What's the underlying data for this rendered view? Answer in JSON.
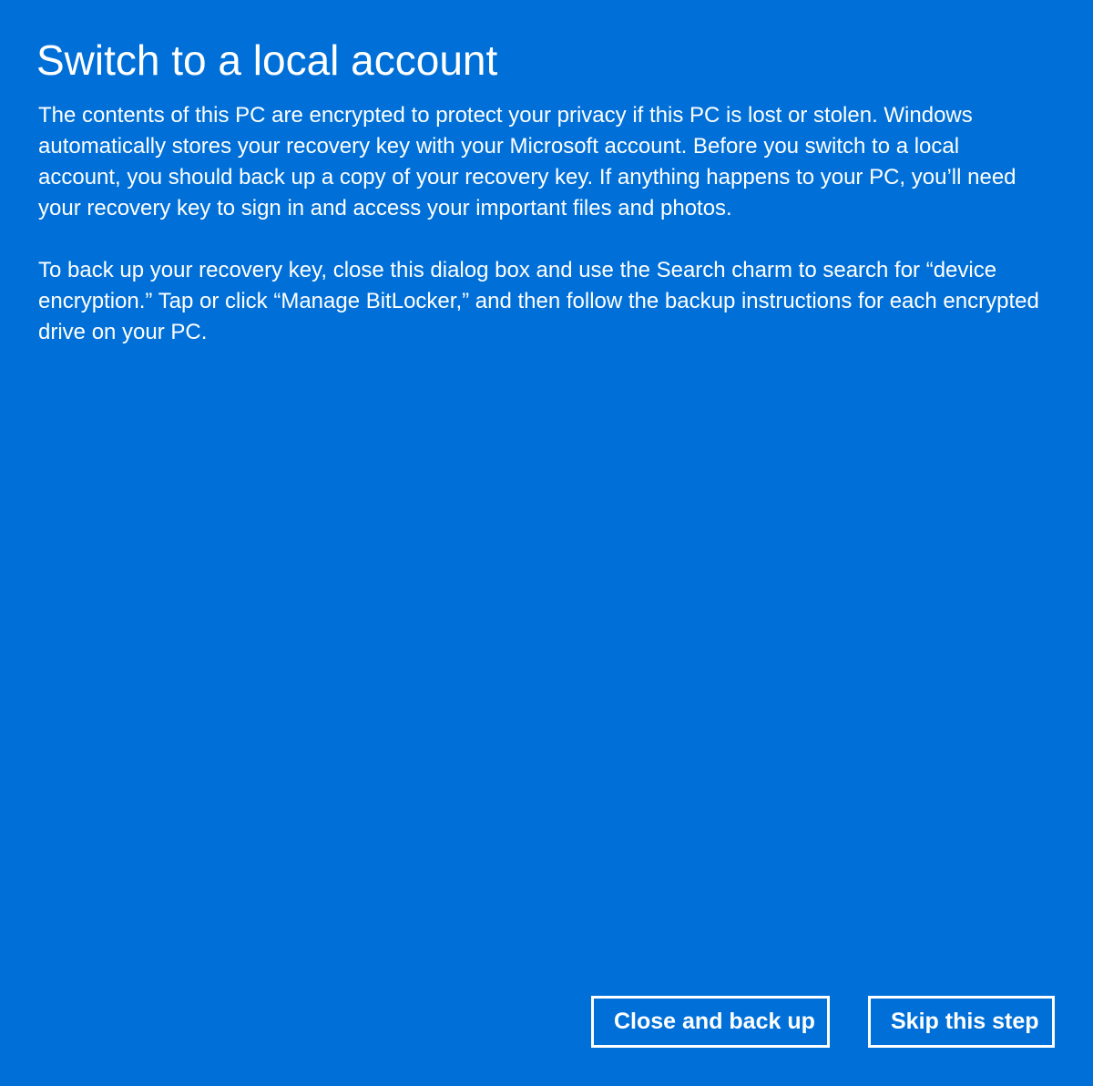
{
  "dialog": {
    "title": "Switch to a local account",
    "paragraph_1": "The contents of this PC are encrypted to protect your privacy if this PC is lost or stolen. Windows automatically stores your recovery key with your Microsoft account. Before you switch to a local account, you should back up a copy of your recovery key. If anything happens to your PC, you’ll need your recovery key to sign in and access your important files and photos.",
    "paragraph_2": "To back up your recovery key, close this dialog box and use the Search charm to search for “device encryption.” Tap or click “Manage BitLocker,” and then follow the backup instructions for each encrypted drive on your PC.",
    "buttons": {
      "close_and_back_up": "Close and back up",
      "skip_this_step": "Skip this step"
    }
  },
  "colors": {
    "background": "#0070d8",
    "text": "#ffffff",
    "button_border": "#ffffff"
  }
}
